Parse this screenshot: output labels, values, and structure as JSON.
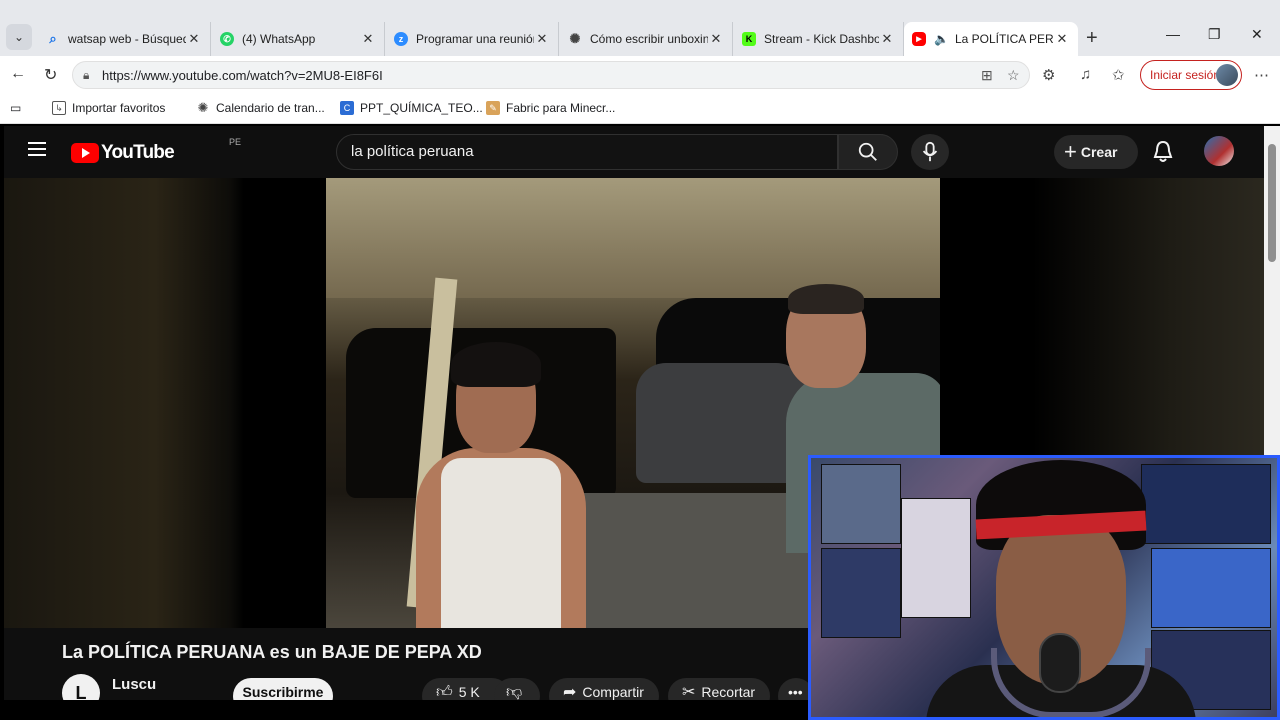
{
  "browser": {
    "tabs": [
      {
        "title": "watsap web - Búsqueda",
        "icon": "search-icon",
        "color": "#1a73e8"
      },
      {
        "title": "(4) WhatsApp",
        "icon": "whatsapp-icon",
        "color": "#25d366"
      },
      {
        "title": "Programar una reunión",
        "icon": "zoom-icon",
        "color": "#2d8cff"
      },
      {
        "title": "Cómo escribir unboxing",
        "icon": "openai-icon",
        "color": "#444444"
      },
      {
        "title": "Stream - Kick Dashboard",
        "icon": "kick-icon",
        "color": "#53fc18"
      },
      {
        "title": "La POLÍTICA PERUANA",
        "icon": "youtube-icon",
        "color": "#ff0000"
      }
    ],
    "url": "https://www.youtube.com/watch?v=2MU8-EI8F6I",
    "signin_label": "Iniciar sesión",
    "bookmarks": [
      {
        "label": "Importar favoritos",
        "icon": "import-icon"
      },
      {
        "label": "Calendario de tran...",
        "icon": "openai-icon"
      },
      {
        "label": "PPT_QUÍMICA_TEO...",
        "icon": "canva-icon"
      },
      {
        "label": "Fabric para Minecr...",
        "icon": "fabric-icon"
      }
    ]
  },
  "youtube": {
    "logo": "YouTube",
    "country": "PE",
    "search_query": "la política peruana",
    "create_label": "Crear",
    "video_title": "La POLÍTICA PERUANA es un BAJE DE PEPA XD",
    "channel_initial": "L",
    "channel_name": "Luscu",
    "subscribe_label": "Suscribirme",
    "likes": "5 K",
    "share_label": "Compartir",
    "clip_label": "Recortar"
  },
  "colors": {
    "yt_background": "#0f0f0f",
    "yt_red": "#ff0000",
    "signin_red": "#c5221f",
    "webcam_border": "#2b5cff"
  }
}
